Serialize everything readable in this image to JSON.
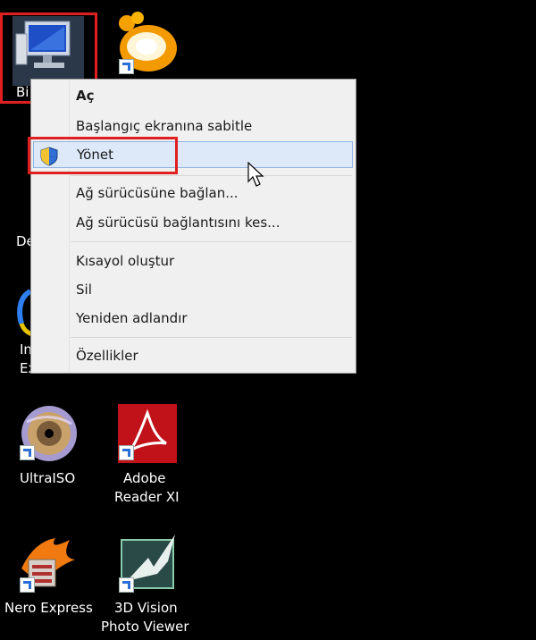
{
  "desktop": {
    "icons": [
      {
        "label": "Bi",
        "name": "computer"
      },
      {
        "label": "",
        "name": "gom-player"
      },
      {
        "label": "De",
        "name": "desktop-partial"
      },
      {
        "label1": "In",
        "label2": "Ex",
        "name": "internet-explorer"
      },
      {
        "label": "UltraISO",
        "name": "ultraiso"
      },
      {
        "label1": "Adobe",
        "label2": "Reader XI",
        "name": "adobe-reader"
      },
      {
        "label": "Nero Express",
        "name": "nero-express"
      },
      {
        "label1": "3D Vision",
        "label2": "Photo Viewer",
        "name": "3d-vision"
      }
    ]
  },
  "context_menu": {
    "items": [
      {
        "label": "Aç",
        "bold": true
      },
      {
        "label": "Başlangıç ekranına sabitle"
      },
      {
        "label": "Yönet",
        "icon": "shield-icon",
        "highlighted": true
      },
      {
        "label": "Ağ sürücüsüne bağlan..."
      },
      {
        "label": "Ağ sürücüsü bağlantısını kes..."
      },
      {
        "label": "Kısayol oluştur"
      },
      {
        "label": "Sil"
      },
      {
        "label": "Yeniden adlandır"
      },
      {
        "label": "Özellikler"
      }
    ]
  },
  "colors": {
    "highlight_box": "#e02020",
    "menu_bg": "#f0f0f0",
    "hover_bg": "#dde9f8"
  }
}
